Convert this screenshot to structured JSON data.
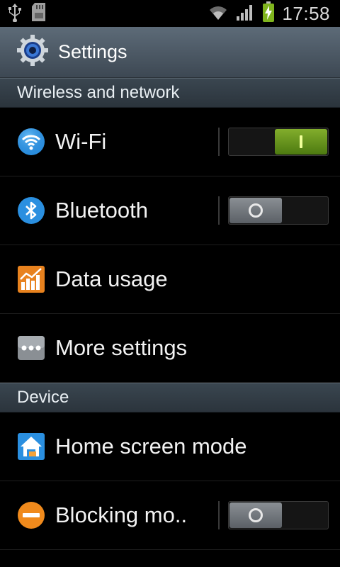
{
  "status_bar": {
    "time": "17:58",
    "icons": [
      "usb-icon",
      "sd-card-icon",
      "wifi-signal-icon",
      "cell-signal-icon",
      "battery-charging-icon"
    ]
  },
  "action_bar": {
    "title": "Settings",
    "icon": "settings-gear-icon"
  },
  "sections": [
    {
      "header": "Wireless and network",
      "items": [
        {
          "label": "Wi-Fi",
          "icon": "wifi-icon",
          "toggle": "on"
        },
        {
          "label": "Bluetooth",
          "icon": "bluetooth-icon",
          "toggle": "off"
        },
        {
          "label": "Data usage",
          "icon": "data-usage-icon"
        },
        {
          "label": "More settings",
          "icon": "more-settings-icon"
        }
      ]
    },
    {
      "header": "Device",
      "items": [
        {
          "label": "Home screen mode",
          "icon": "home-screen-icon"
        },
        {
          "label": "Blocking mo..",
          "icon": "blocking-mode-icon",
          "toggle": "off"
        }
      ]
    }
  ],
  "colors": {
    "toggle_on": "#6a9a1e",
    "action_bar": "#4d5965",
    "section_header": "#333d46"
  }
}
